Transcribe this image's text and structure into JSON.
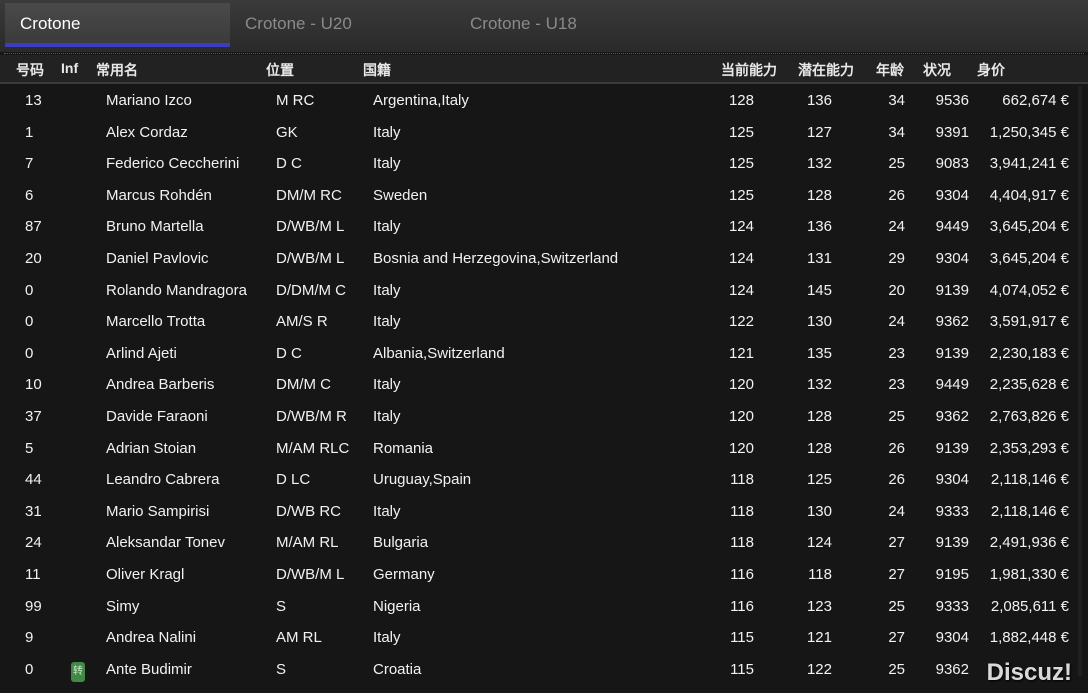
{
  "tabs": [
    {
      "label": "Crotone"
    },
    {
      "label": "Crotone - U20"
    },
    {
      "label": "Crotone - U18"
    }
  ],
  "columns": {
    "number": "号码",
    "inf": "Inf",
    "name": "常用名",
    "position": "位置",
    "nationality": "国籍",
    "current_ability": "当前能力",
    "potential_ability": "潜在能力",
    "age": "年龄",
    "condition": "状况",
    "value": "身价"
  },
  "players": [
    {
      "number": "13",
      "name": "Mariano Izco",
      "position": "M RC",
      "nationality": "Argentina,Italy",
      "ca": "128",
      "pa": "136",
      "age": "34",
      "condition": "9536",
      "value": "662,674 €"
    },
    {
      "number": "1",
      "name": "Alex Cordaz",
      "position": "GK",
      "nationality": "Italy",
      "ca": "125",
      "pa": "127",
      "age": "34",
      "condition": "9391",
      "value": "1,250,345 €"
    },
    {
      "number": "7",
      "name": "Federico Ceccherini",
      "position": "D C",
      "nationality": "Italy",
      "ca": "125",
      "pa": "132",
      "age": "25",
      "condition": "9083",
      "value": "3,941,241 €"
    },
    {
      "number": "6",
      "name": "Marcus Rohdén",
      "position": "DM/M RC",
      "nationality": "Sweden",
      "ca": "125",
      "pa": "128",
      "age": "26",
      "condition": "9304",
      "value": "4,404,917 €"
    },
    {
      "number": "87",
      "name": "Bruno Martella",
      "position": "D/WB/M L",
      "nationality": "Italy",
      "ca": "124",
      "pa": "136",
      "age": "24",
      "condition": "9449",
      "value": "3,645,204 €"
    },
    {
      "number": "20",
      "name": "Daniel Pavlovic",
      "position": "D/WB/M L",
      "nationality": "Bosnia and Herzegovina,Switzerland",
      "ca": "124",
      "pa": "131",
      "age": "29",
      "condition": "9304",
      "value": "3,645,204 €"
    },
    {
      "number": "0",
      "name": "Rolando Mandragora",
      "position": "D/DM/M C",
      "nationality": "Italy",
      "ca": "124",
      "pa": "145",
      "age": "20",
      "condition": "9139",
      "value": "4,074,052 €"
    },
    {
      "number": "0",
      "name": "Marcello Trotta",
      "position": "AM/S R",
      "nationality": "Italy",
      "ca": "122",
      "pa": "130",
      "age": "24",
      "condition": "9362",
      "value": "3,591,917 €"
    },
    {
      "number": "0",
      "name": "Arlind Ajeti",
      "position": "D C",
      "nationality": "Albania,Switzerland",
      "ca": "121",
      "pa": "135",
      "age": "23",
      "condition": "9139",
      "value": "2,230,183 €"
    },
    {
      "number": "10",
      "name": "Andrea Barberis",
      "position": "DM/M C",
      "nationality": "Italy",
      "ca": "120",
      "pa": "132",
      "age": "23",
      "condition": "9449",
      "value": "2,235,628 €"
    },
    {
      "number": "37",
      "name": "Davide Faraoni",
      "position": "D/WB/M R",
      "nationality": "Italy",
      "ca": "120",
      "pa": "128",
      "age": "25",
      "condition": "9362",
      "value": "2,763,826 €"
    },
    {
      "number": "5",
      "name": "Adrian Stoian",
      "position": "M/AM RLC",
      "nationality": "Romania",
      "ca": "120",
      "pa": "128",
      "age": "26",
      "condition": "9139",
      "value": "2,353,293 €"
    },
    {
      "number": "44",
      "name": "Leandro Cabrera",
      "position": "D LC",
      "nationality": "Uruguay,Spain",
      "ca": "118",
      "pa": "125",
      "age": "26",
      "condition": "9304",
      "value": "2,118,146 €"
    },
    {
      "number": "31",
      "name": "Mario Sampirisi",
      "position": "D/WB RC",
      "nationality": "Italy",
      "ca": "118",
      "pa": "130",
      "age": "24",
      "condition": "9333",
      "value": "2,118,146 €"
    },
    {
      "number": "24",
      "name": "Aleksandar Tonev",
      "position": "M/AM RL",
      "nationality": "Bulgaria",
      "ca": "118",
      "pa": "124",
      "age": "27",
      "condition": "9139",
      "value": "2,491,936 €"
    },
    {
      "number": "11",
      "name": "Oliver Kragl",
      "position": "D/WB/M L",
      "nationality": "Germany",
      "ca": "116",
      "pa": "118",
      "age": "27",
      "condition": "9195",
      "value": "1,981,330 €"
    },
    {
      "number": "99",
      "name": "Simy",
      "position": "S",
      "nationality": "Nigeria",
      "ca": "116",
      "pa": "123",
      "age": "25",
      "condition": "9333",
      "value": "2,085,611 €"
    },
    {
      "number": "9",
      "name": "Andrea Nalini",
      "position": "AM RL",
      "nationality": "Italy",
      "ca": "115",
      "pa": "121",
      "age": "27",
      "condition": "9304",
      "value": "1,882,448 €"
    },
    {
      "number": "0",
      "name": "Ante Budimir",
      "position": "S",
      "nationality": "Croatia",
      "ca": "115",
      "pa": "122",
      "age": "25",
      "condition": "9362",
      "value": "",
      "inf_badge": "转"
    }
  ],
  "watermark": "Discuz!",
  "colors": {
    "tab_accent": "#3b3ec0",
    "badge_green": "#3f8a45",
    "background": "#161616"
  }
}
